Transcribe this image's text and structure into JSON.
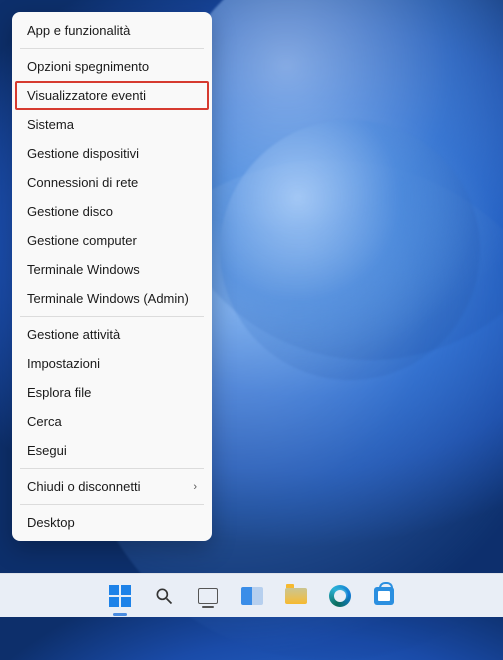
{
  "context_menu": {
    "items": [
      {
        "label": "App e funzionalità",
        "separator_after": true
      },
      {
        "label": "Opzioni spegnimento"
      },
      {
        "label": "Visualizzatore eventi",
        "highlighted": true
      },
      {
        "label": "Sistema"
      },
      {
        "label": "Gestione dispositivi"
      },
      {
        "label": "Connessioni di rete"
      },
      {
        "label": "Gestione disco"
      },
      {
        "label": "Gestione computer"
      },
      {
        "label": "Terminale Windows"
      },
      {
        "label": "Terminale Windows (Admin)",
        "separator_after": true
      },
      {
        "label": "Gestione attività"
      },
      {
        "label": "Impostazioni"
      },
      {
        "label": "Esplora file"
      },
      {
        "label": "Cerca"
      },
      {
        "label": "Esegui",
        "separator_after": true
      },
      {
        "label": "Chiudi o disconnetti",
        "has_submenu": true,
        "separator_after": true
      },
      {
        "label": "Desktop"
      }
    ]
  },
  "taskbar": {
    "icons": [
      {
        "name": "start-icon",
        "active": true
      },
      {
        "name": "search-icon"
      },
      {
        "name": "task-view-icon"
      },
      {
        "name": "widgets-icon"
      },
      {
        "name": "file-explorer-icon"
      },
      {
        "name": "edge-icon"
      },
      {
        "name": "microsoft-store-icon"
      }
    ]
  },
  "highlight_color": "#d63a2f"
}
